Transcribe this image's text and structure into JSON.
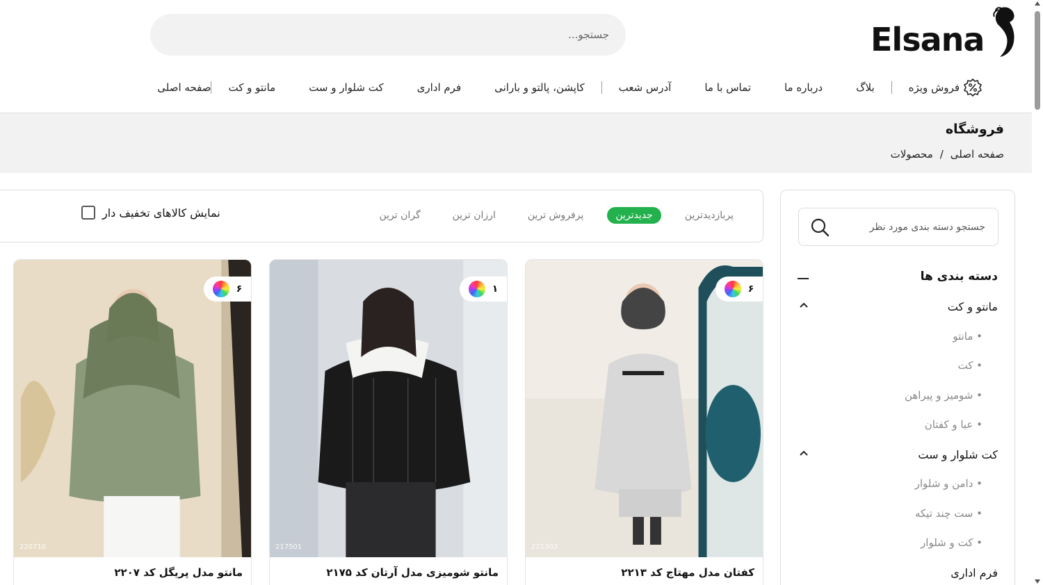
{
  "header": {
    "logo_text": "Elsana",
    "search_placeholder": "جستجو..."
  },
  "nav": {
    "items": [
      {
        "label": "صفحه اصلی"
      },
      {
        "label": "مانتو و کت"
      },
      {
        "label": "کت شلوار و ست"
      },
      {
        "label": "فرم اداری"
      },
      {
        "label": "کاپشن، پالتو و بارانی"
      },
      {
        "label": "آدرس شعب"
      },
      {
        "label": "تماس با ما"
      },
      {
        "label": "درباره ما"
      },
      {
        "label": "بلاگ"
      },
      {
        "label": "فروش ویژه"
      }
    ]
  },
  "page": {
    "title": "فروشگاه",
    "breadcrumb": [
      "صفحه اصلی",
      "/",
      "محصولات"
    ]
  },
  "sort": {
    "options": [
      "پربازدیدترین",
      "جدیدترین",
      "پرفروش ترین",
      "ارزان ترین",
      "گران ترین"
    ],
    "active": "جدیدترین",
    "discount_label": "نمایش کالاهای تخفیف دار"
  },
  "sidebar": {
    "search_placeholder": "جستجو دسته بندی مورد نظر",
    "categories_title": "دسته بندی ها",
    "categories": [
      {
        "label": "مانتو و کت",
        "type": "parent"
      },
      {
        "label": "• مانتو",
        "type": "sub"
      },
      {
        "label": "• کت",
        "type": "sub"
      },
      {
        "label": "• شومیز و پیراهن",
        "type": "sub"
      },
      {
        "label": "• عبا و کفتان",
        "type": "sub"
      },
      {
        "label": "کت شلوار و ست",
        "type": "parent"
      },
      {
        "label": "• دامن و شلوار",
        "type": "sub"
      },
      {
        "label": "• ست چند تیکه",
        "type": "sub"
      },
      {
        "label": "• کت و شلوار",
        "type": "sub"
      },
      {
        "label": "فرم اداری",
        "type": "parent"
      }
    ]
  },
  "products": [
    {
      "title": "کفتان مدل مهتاج کد ۲۲۱۳",
      "code": "221303",
      "color_count": "۶"
    },
    {
      "title": "مانتو شومیزی مدل آرتان کد ۲۱۷۵",
      "code": "217501",
      "color_count": "۱"
    },
    {
      "title": "مانتو مدل پریگل کد ۲۲۰۷",
      "code": "220710",
      "color_count": "۶"
    }
  ],
  "colors": {
    "accent_green": "#22b14c",
    "band_bg": "#f2f2f2"
  }
}
